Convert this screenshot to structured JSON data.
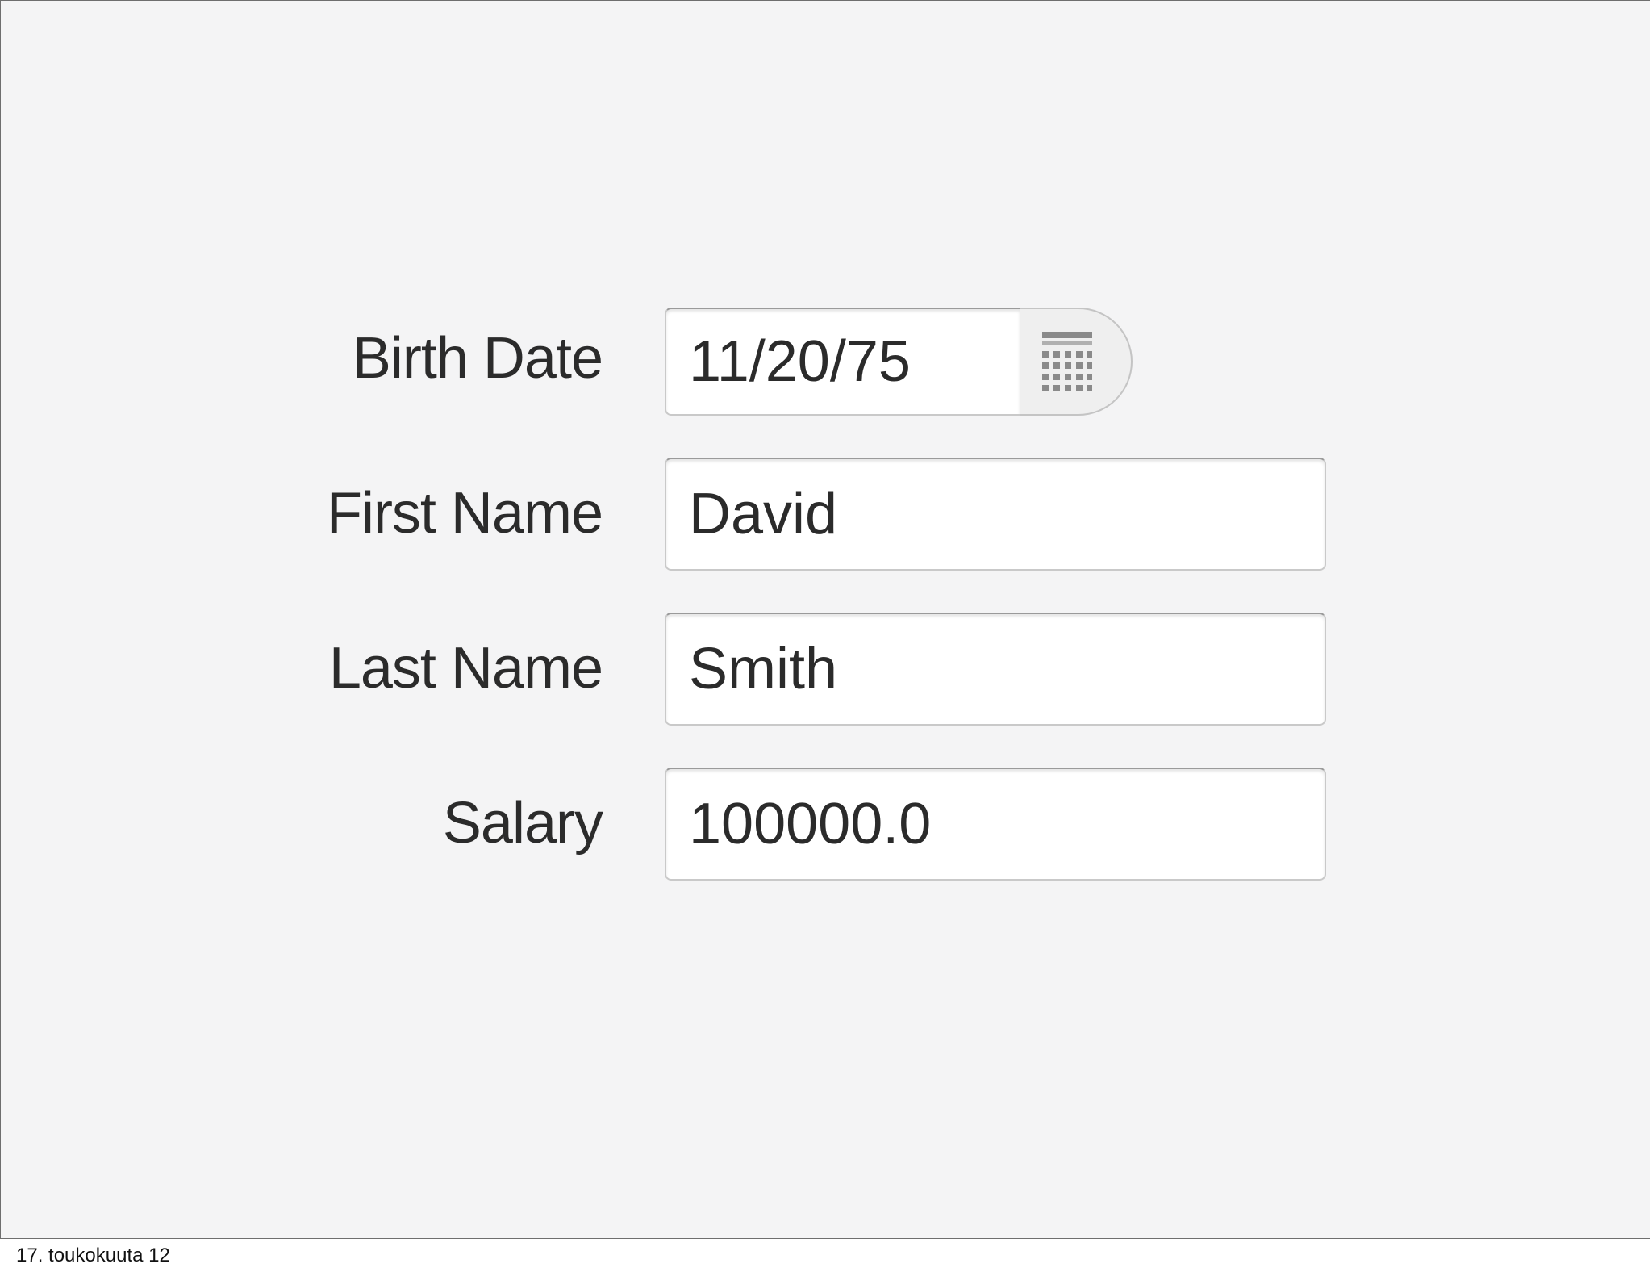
{
  "form": {
    "birth_date": {
      "label": "Birth Date",
      "value": "11/20/75",
      "picker_icon": "calendar-icon"
    },
    "first_name": {
      "label": "First Name",
      "value": "David"
    },
    "last_name": {
      "label": "Last Name",
      "value": "Smith"
    },
    "salary": {
      "label": "Salary",
      "value": "100000.0"
    }
  },
  "footer": {
    "date": "17. toukokuuta 12"
  },
  "colors": {
    "background": "#f4f4f5",
    "field_background": "#ffffff",
    "text": "#2b2b2b",
    "field_border": "#c9c9c9"
  }
}
